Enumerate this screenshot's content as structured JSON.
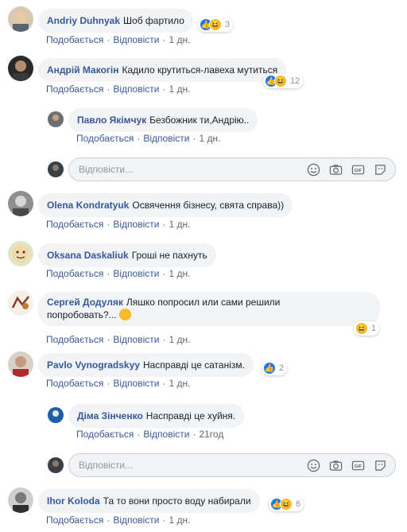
{
  "placeholder": "Відповісти...",
  "like_label": "Подобається",
  "reply_label": "Відповісти",
  "comments": [
    {
      "author": "Andriy Duhnyak",
      "text": "Шоб фартило",
      "time": "1 дн.",
      "count": "3"
    },
    {
      "author": "Андрій Макогін",
      "text": "Кадило крутиться-лавеха мутиться",
      "time": "1 дн.",
      "count": "12"
    },
    {
      "author": "Павло Якімчук",
      "text": "Безбожник ти,Андрію..",
      "time": "1 дн."
    },
    {
      "author": "Olena Kondratyuk",
      "text": "Освячення бізнесу, свята справа))",
      "time": "1 дн."
    },
    {
      "author": "Oksana Daskaliuk",
      "text": "Гроші не пахнуть",
      "time": "1 дн."
    },
    {
      "author": "Сергей Додуляк",
      "text": "Ляшко попросил или сами решили",
      "text2": "попробовать?...",
      "time": "1 дн.",
      "count": "1"
    },
    {
      "author": "Pavlo Vynogradskyy",
      "text": "Насправді це сатанізм.",
      "time": "1 дн.",
      "count": "2"
    },
    {
      "author": "Діма Зінченко",
      "text": "Насправді це хуйня.",
      "time": "21год"
    },
    {
      "author": "Ihor Koloda",
      "text": "Та то вони просто воду набирали",
      "time": "1 дн.",
      "count": "6"
    }
  ],
  "colors": {
    "link": "#385898",
    "bubble": "#f2f3f5",
    "like": "#1877f2",
    "haha": "#f7b928"
  },
  "icons": [
    "smiley-icon",
    "camera-icon",
    "gif-icon",
    "sticker-icon"
  ]
}
